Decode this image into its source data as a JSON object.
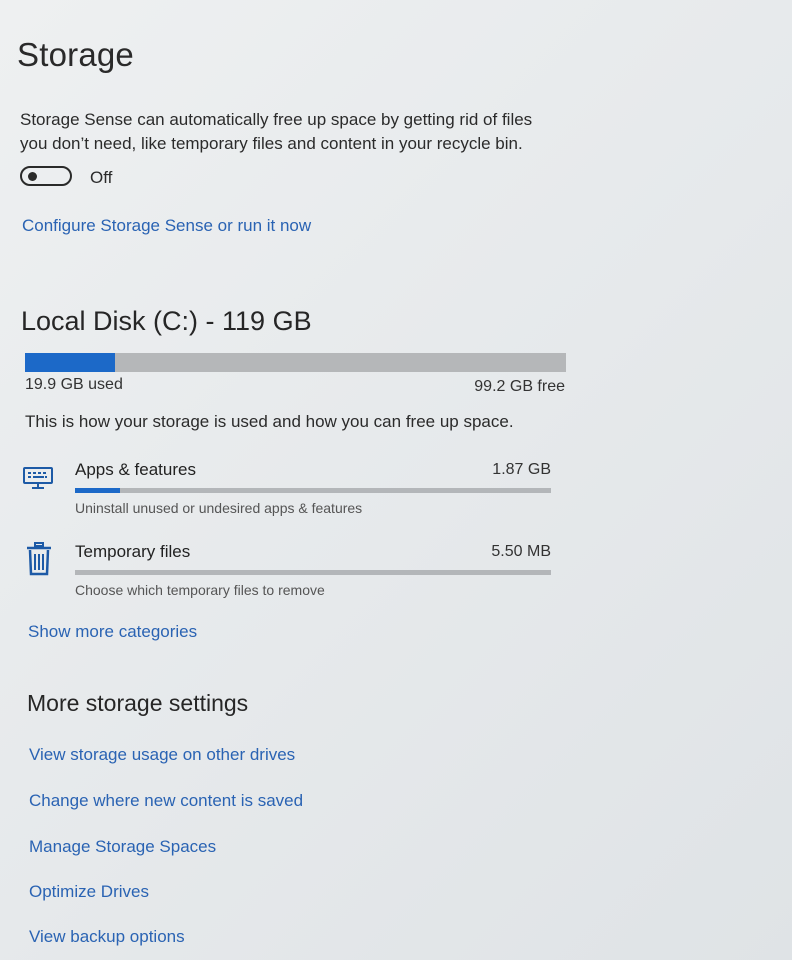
{
  "page": {
    "title": "Storage",
    "description_line1": "Storage Sense can automatically free up space by getting rid of files",
    "description_line2": "you don’t need, like temporary files and content in your recycle bin."
  },
  "storage_sense": {
    "toggle_state": "Off",
    "is_on": false,
    "configure_link": "Configure Storage Sense or run it now"
  },
  "disk": {
    "title": "Local Disk (C:) - 119 GB",
    "used_label": "19.9 GB used",
    "free_label": "99.2 GB free",
    "used_fraction": 0.167,
    "usage_explanation": "This is how your storage is used and how you can free up space."
  },
  "categories": [
    {
      "name": "Apps & features",
      "size": "1.87 GB",
      "description": "Uninstall unused or undesired apps & features",
      "icon": "keyboard-monitor-icon",
      "fill_fraction": 0.094
    },
    {
      "name": "Temporary files",
      "size": "5.50 MB",
      "description": "Choose which temporary files to remove",
      "icon": "trash-icon",
      "fill_fraction": 0.0
    }
  ],
  "show_more_link": "Show more categories",
  "more_settings": {
    "title": "More storage settings",
    "links": [
      "View storage usage on other drives",
      "Change where new content is saved",
      "Manage Storage Spaces",
      "Optimize Drives",
      "View backup options"
    ]
  },
  "colors": {
    "accent": "#1c69c8",
    "link": "#2a63b3",
    "bar_track": "#b5b7b9"
  }
}
